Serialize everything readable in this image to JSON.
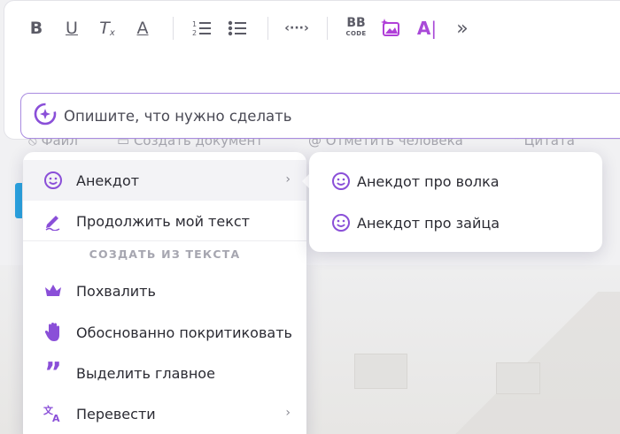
{
  "toolbar": {
    "buttons": [
      "bold-icon",
      "underline-icon",
      "clear-format-icon",
      "text-color-icon",
      "numbered-list-icon",
      "bulleted-list-icon",
      "code-icon",
      "bbcode-icon",
      "image-ai-icon",
      "text-ai-icon",
      "more-icon"
    ],
    "bb_label": "BB",
    "bb_sub": "CODE"
  },
  "prompt": {
    "placeholder": "Опишите, что нужно сделать"
  },
  "ghost_row": {
    "file": "Файл",
    "create_doc": "Создать документ",
    "mention": "Отметить человека",
    "quote": "Цитата"
  },
  "menu": {
    "items": [
      {
        "label": "Анекдот",
        "icon": "smile-icon",
        "submenu": true
      },
      {
        "label": "Продолжить мой текст",
        "icon": "pen-icon"
      }
    ],
    "section_title": "СОЗДАТЬ ИЗ ТЕКСТА",
    "section_items": [
      {
        "label": "Похвалить",
        "icon": "crown-icon"
      },
      {
        "label": "Обоснованно покритиковать",
        "icon": "hand-icon"
      },
      {
        "label": "Выделить главное",
        "icon": "quote-icon"
      },
      {
        "label": "Перевести",
        "icon": "translate-icon",
        "submenu": true
      }
    ]
  },
  "submenu": {
    "items": [
      {
        "label": "Анекдот про волка",
        "icon": "smile-icon"
      },
      {
        "label": "Анекдот про зайца",
        "icon": "smile-icon"
      }
    ]
  },
  "colors": {
    "accent": "#8a4fd8",
    "toolbar_icon": "#5b5b66",
    "focus_border": "#a98be0"
  }
}
